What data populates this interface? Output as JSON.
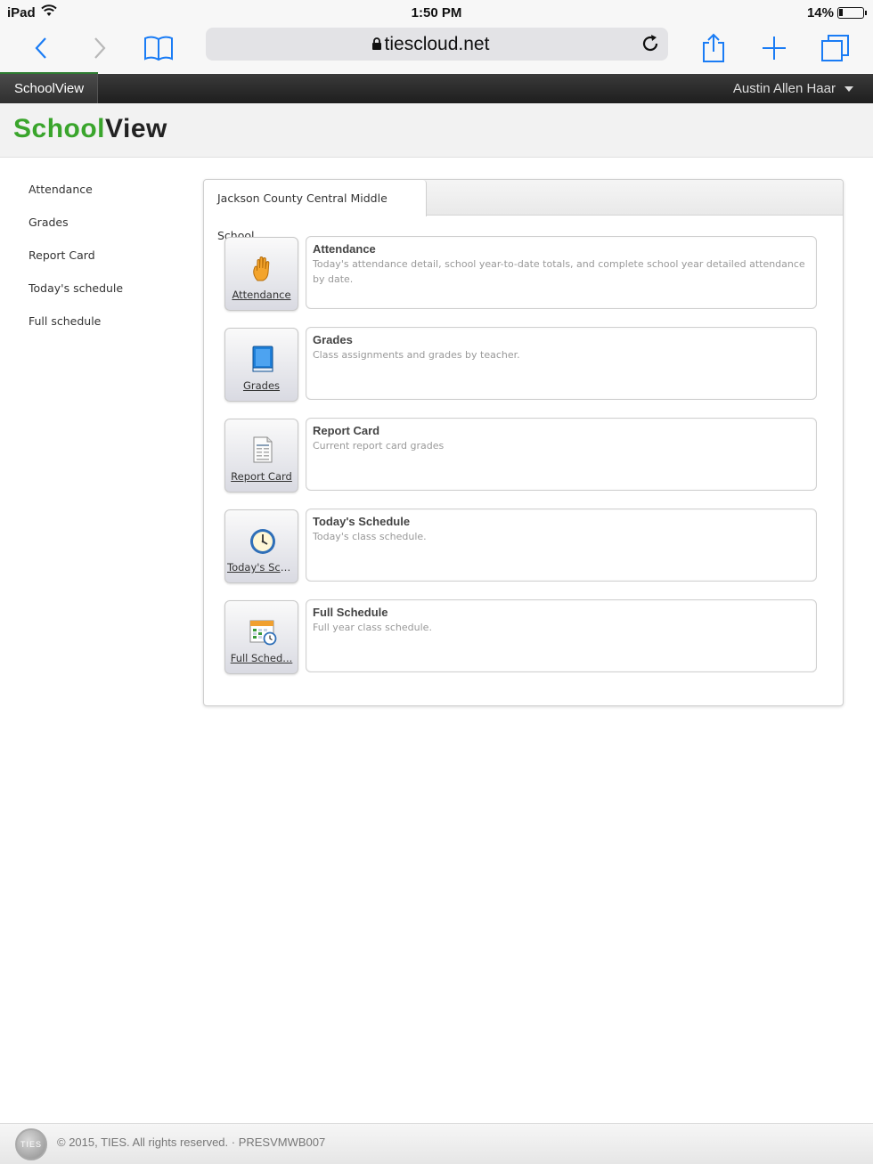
{
  "status_bar": {
    "device": "iPad",
    "time": "1:50 PM",
    "battery": "14%"
  },
  "browser": {
    "url": "tiescloud.net"
  },
  "app_header": {
    "tab": "SchoolView",
    "user": "Austin Allen Haar"
  },
  "brand": {
    "part1": "School",
    "part2": "View"
  },
  "left_nav": {
    "items": [
      {
        "label": "Attendance"
      },
      {
        "label": "Grades"
      },
      {
        "label": "Report Card"
      },
      {
        "label": "Today's schedule"
      },
      {
        "label": "Full schedule"
      }
    ]
  },
  "panel": {
    "tab": "Jackson County Central Middle School",
    "rows": [
      {
        "icon": "hand-icon",
        "button_label": "Attendance",
        "title": "Attendance",
        "text": "Today's attendance detail, school year-to-date totals, and complete school year detailed attendance by date."
      },
      {
        "icon": "book-icon",
        "button_label": "Grades",
        "title": "Grades",
        "text": "Class assignments and grades by teacher."
      },
      {
        "icon": "report-card-icon",
        "button_label": "Report Card",
        "title": "Report Card",
        "text": "Current report card grades"
      },
      {
        "icon": "clock-icon",
        "button_label": "Today's Sch...",
        "title": "Today's Schedule",
        "text": "Today's class schedule."
      },
      {
        "icon": "calendar-icon",
        "button_label": "Full Sched...",
        "title": "Full Schedule",
        "text": "Full year class schedule."
      }
    ]
  },
  "footer": {
    "logo": "TIES",
    "copyright": "© 2015, TIES. All rights reserved. · PRESVMWB007"
  }
}
